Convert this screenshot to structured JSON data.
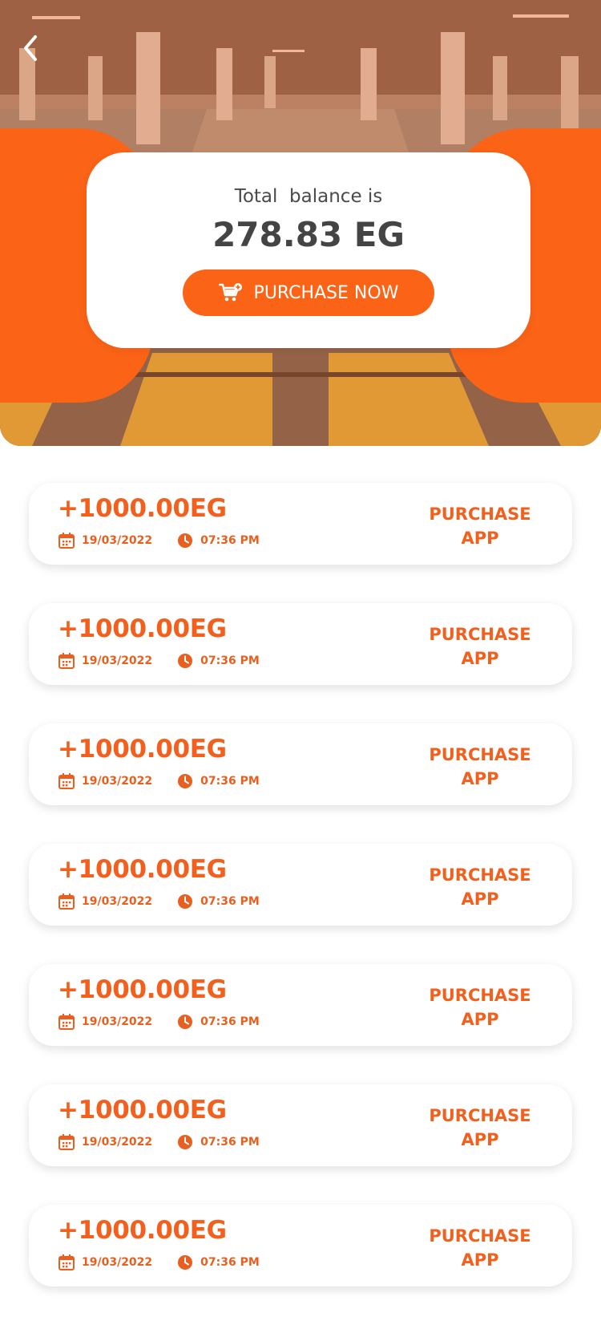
{
  "colors": {
    "accent": "#fb6316",
    "text_dark": "#444444",
    "card": "#ffffff"
  },
  "header": {
    "back_icon": "chevron-left-icon"
  },
  "balance": {
    "label": "Total  balance is",
    "value": "278.83 EG",
    "button_label": "PURCHASE NOW",
    "button_icon": "cart-add-icon"
  },
  "transactions": [
    {
      "amount": "+1000.00EG",
      "date": "19/03/2022",
      "time": "07:36 PM",
      "type_line1": "PURCHASE",
      "type_line2": "APP"
    },
    {
      "amount": "+1000.00EG",
      "date": "19/03/2022",
      "time": "07:36 PM",
      "type_line1": "PURCHASE",
      "type_line2": "APP"
    },
    {
      "amount": "+1000.00EG",
      "date": "19/03/2022",
      "time": "07:36 PM",
      "type_line1": "PURCHASE",
      "type_line2": "APP"
    },
    {
      "amount": "+1000.00EG",
      "date": "19/03/2022",
      "time": "07:36 PM",
      "type_line1": "PURCHASE",
      "type_line2": "APP"
    },
    {
      "amount": "+1000.00EG",
      "date": "19/03/2022",
      "time": "07:36 PM",
      "type_line1": "PURCHASE",
      "type_line2": "APP"
    },
    {
      "amount": "+1000.00EG",
      "date": "19/03/2022",
      "time": "07:36 PM",
      "type_line1": "PURCHASE",
      "type_line2": "APP"
    },
    {
      "amount": "+1000.00EG",
      "date": "19/03/2022",
      "time": "07:36 PM",
      "type_line1": "PURCHASE",
      "type_line2": "APP"
    }
  ]
}
